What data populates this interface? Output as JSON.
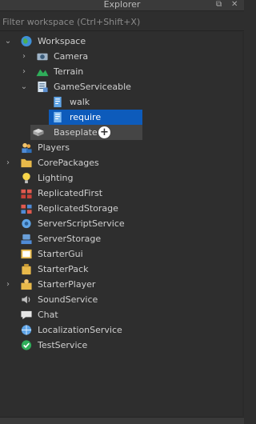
{
  "window": {
    "title": "Explorer",
    "pin_icon": "pin-icon",
    "close_icon": "close-icon"
  },
  "filter": {
    "placeholder": "Filter workspace (Ctrl+Shift+X)",
    "value": ""
  },
  "tree": {
    "workspace": "Workspace",
    "camera": "Camera",
    "terrain": "Terrain",
    "gameserviceable": "GameServiceable",
    "walk": "walk",
    "require": "require",
    "baseplate": "Baseplate",
    "players": "Players",
    "corepackages": "CorePackages",
    "lighting": "Lighting",
    "replicatedfirst": "ReplicatedFirst",
    "replicatedstorage": "ReplicatedStorage",
    "serverscriptservice": "ServerScriptService",
    "serverstorage": "ServerStorage",
    "startergui": "StarterGui",
    "starterpack": "StarterPack",
    "starterplayer": "StarterPlayer",
    "soundservice": "SoundService",
    "chat": "Chat",
    "localizationservice": "LocalizationService",
    "testservice": "TestService"
  },
  "colors": {
    "selection": "#0d5bbb",
    "background": "#2e2e2e"
  }
}
